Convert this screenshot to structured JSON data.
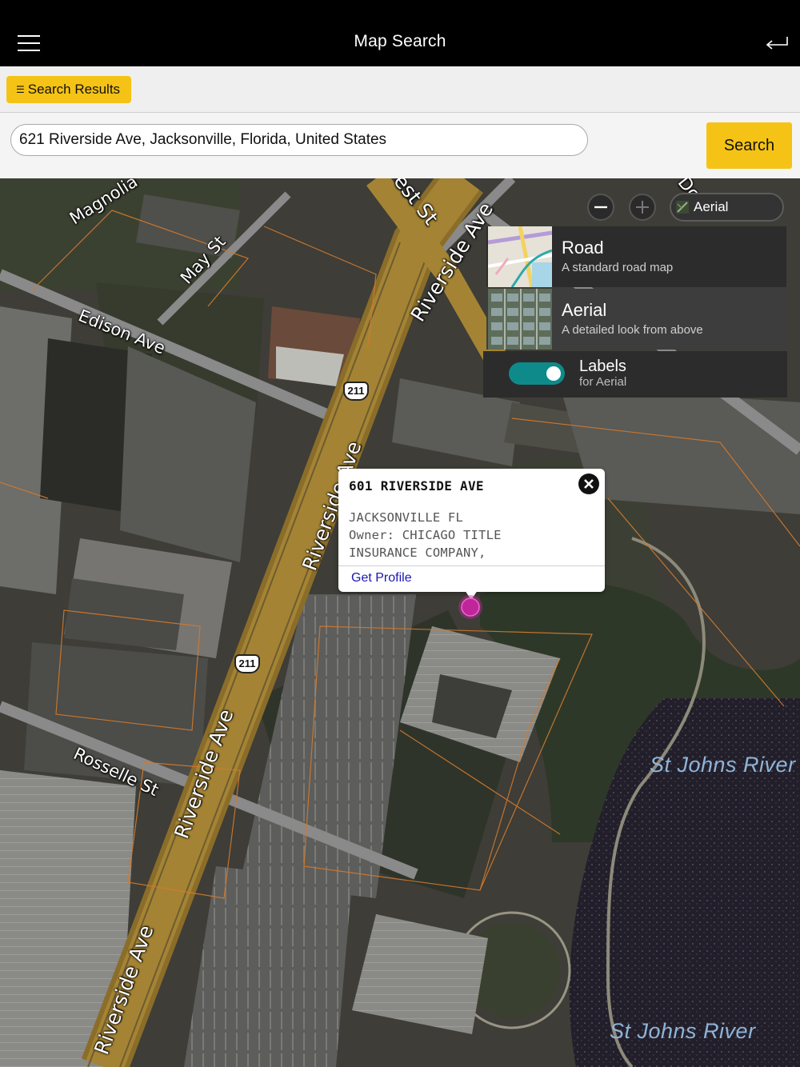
{
  "header": {
    "title": "Map Search",
    "menu_icon": "hamburger-menu-icon",
    "back_icon": "return-arrow-icon"
  },
  "results": {
    "label": "Search Results",
    "icon": "list-icon"
  },
  "search": {
    "value": "621 Riverside Ave, Jacksonville, Florida, United States",
    "button_label": "Search"
  },
  "map_controls": {
    "zoom_out_icon": "minus-icon",
    "zoom_in_icon": "plus-icon",
    "current_style": "Aerial",
    "style_options": [
      {
        "title": "Road",
        "subtitle": "A standard road map"
      },
      {
        "title": "Aerial",
        "subtitle": "A detailed look from above"
      }
    ],
    "labels_toggle": {
      "title": "Labels",
      "subtitle": "for Aerial",
      "on": true
    }
  },
  "info_card": {
    "title": "601 RIVERSIDE AVE",
    "city": "JACKSONVILLE FL",
    "owner": "Owner: CHICAGO TITLE",
    "owner_cont": "INSURANCE COMPANY,",
    "link": "Get Profile"
  },
  "map_labels": {
    "streets": [
      "Magnolia",
      "May St",
      "Edison Ave",
      "Riverside Ave",
      "Riverside Ave",
      "Riverside Ave",
      "Riverside Ave",
      "Rosselle St",
      "est St",
      "Dc"
    ],
    "shields": [
      "211",
      "211"
    ],
    "water": [
      "St Johns River",
      "St Johns River"
    ]
  },
  "colors": {
    "accent": "#f5c315",
    "toggle_on": "#0e8a8a",
    "pin": "#c0269a",
    "link": "#1a17b5"
  }
}
